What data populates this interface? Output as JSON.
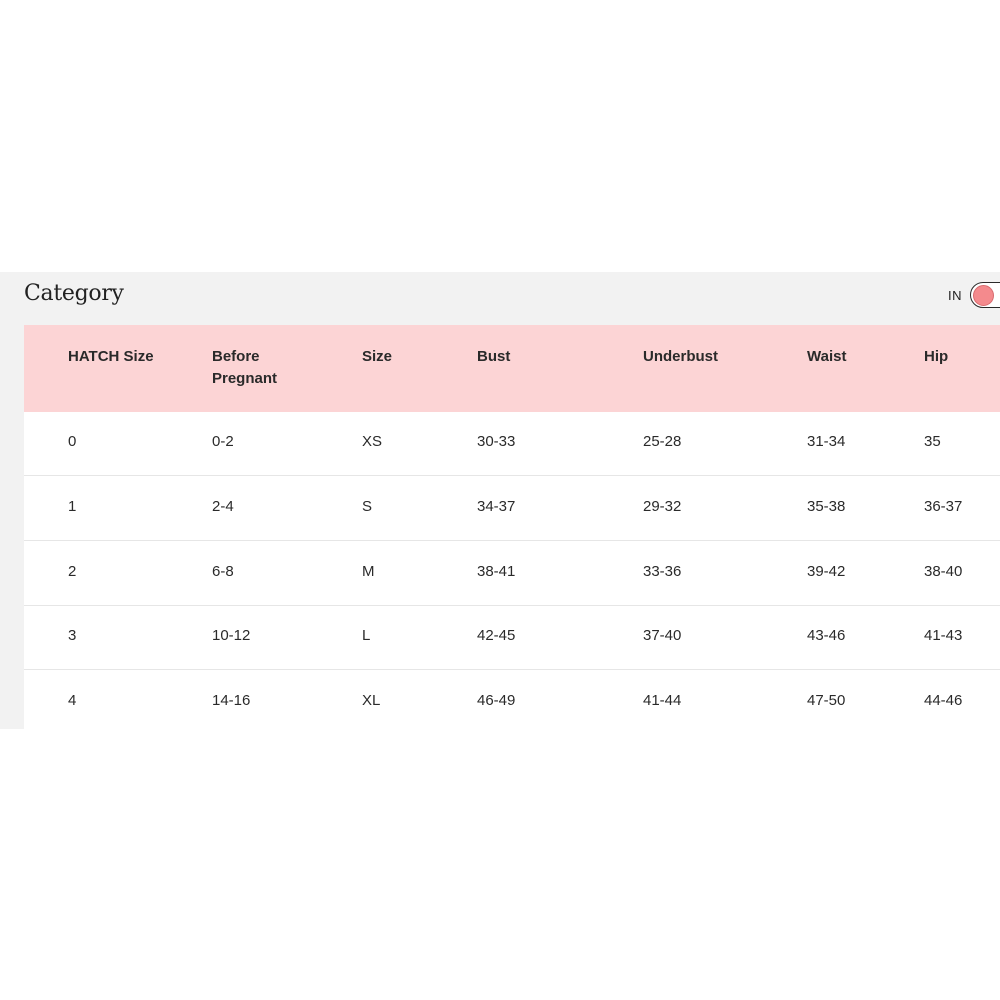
{
  "size_chart": {
    "title": "Category",
    "unit_toggle": {
      "label": "IN"
    },
    "columns": [
      "HATCH Size",
      "Before Pregnant",
      "Size",
      "Bust",
      "Underbust",
      "Waist",
      "Hip"
    ],
    "rows": [
      [
        "0",
        "0-2",
        "XS",
        "30-33",
        "25-28",
        "31-34",
        "35"
      ],
      [
        "1",
        "2-4",
        "S",
        "34-37",
        "29-32",
        "35-38",
        "36-37"
      ],
      [
        "2",
        "6-8",
        "M",
        "38-41",
        "33-36",
        "39-42",
        "38-40"
      ],
      [
        "3",
        "10-12",
        "L",
        "42-45",
        "37-40",
        "43-46",
        "41-43"
      ],
      [
        "4",
        "14-16",
        "XL",
        "46-49",
        "41-44",
        "47-50",
        "44-46"
      ]
    ]
  },
  "colors": {
    "header_bg": "#fcd4d5",
    "panel_bg": "#f2f2f2",
    "toggle_knob": "#f48a8d"
  }
}
